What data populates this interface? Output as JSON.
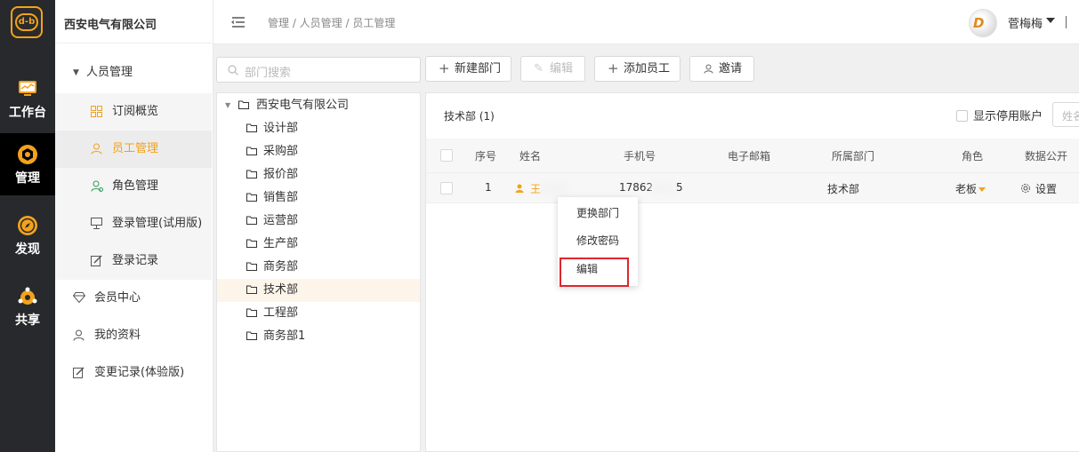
{
  "rail": {
    "logo": "d-b",
    "items": [
      {
        "label": "工作台",
        "icon": "monitor-icon"
      },
      {
        "label": "管理",
        "icon": "hexagon-icon"
      },
      {
        "label": "发现",
        "icon": "compass-icon"
      },
      {
        "label": "共享",
        "icon": "share-icon"
      }
    ]
  },
  "sidebar": {
    "company": "西安电气有限公司",
    "items": [
      {
        "label": "人员管理"
      },
      {
        "label": "订阅概览"
      },
      {
        "label": "员工管理"
      },
      {
        "label": "角色管理"
      },
      {
        "label": "登录管理(试用版)"
      },
      {
        "label": "登录记录"
      },
      {
        "label": "会员中心"
      },
      {
        "label": "我的资料"
      },
      {
        "label": "变更记录(体验版)"
      }
    ]
  },
  "header": {
    "breadcrumb": "管理 / 人员管理 / 员工管理",
    "username": "菅梅梅",
    "separator": "|"
  },
  "toolbar": {
    "search_placeholder": "部门搜索",
    "new_dept": "新建部门",
    "edit": "编辑",
    "add_staff": "添加员工",
    "invite": "邀请"
  },
  "tree": {
    "root": "西安电气有限公司",
    "nodes": [
      "设计部",
      "采购部",
      "报价部",
      "销售部",
      "运营部",
      "生产部",
      "商务部",
      "技术部",
      "工程部",
      "商务部1"
    ]
  },
  "main": {
    "dept_title": "技术部 (1)",
    "show_disabled": "显示停用账户",
    "name_filter_placeholder": "姓名",
    "columns": [
      "序号",
      "姓名",
      "手机号",
      "电子邮箱",
      "所属部门",
      "角色",
      "数据公开"
    ],
    "rows": [
      {
        "index": "1",
        "name_visible": "王",
        "phone_prefix": "17862",
        "phone_suffix": "5",
        "email": "",
        "department": "技术部",
        "role": "老板",
        "data_public": "设置"
      }
    ]
  },
  "context_menu": {
    "items": [
      "更换部门",
      "修改密码",
      "编辑"
    ]
  },
  "colors": {
    "accent": "#f3a21b",
    "rail_bg": "#27292d",
    "highlight": "#e0252c"
  }
}
